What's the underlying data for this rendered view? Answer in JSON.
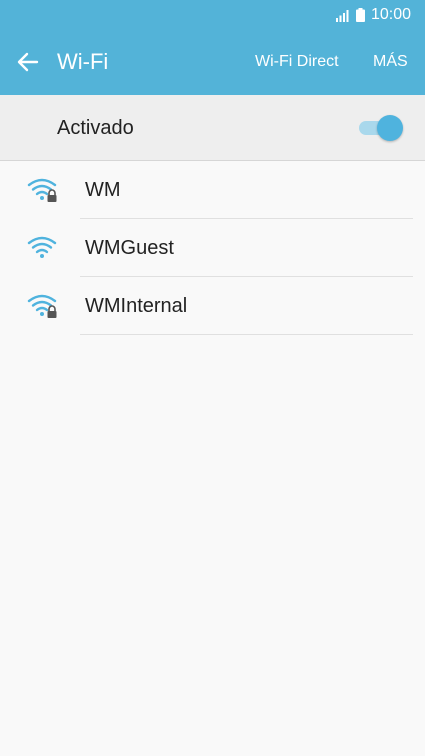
{
  "status_bar": {
    "time": "10:00",
    "icons": [
      "signal-icon",
      "battery-icon"
    ]
  },
  "app_bar": {
    "back_icon": "arrow-left-icon",
    "title": "Wi-Fi",
    "wifi_direct_label": "Wi-Fi Direct",
    "more_label": "MÁS"
  },
  "toggle": {
    "label": "Activado",
    "state": "on"
  },
  "networks": [
    {
      "name": "WM",
      "locked": true
    },
    {
      "name": "WMGuest",
      "locked": false
    },
    {
      "name": "WMInternal",
      "locked": true
    }
  ],
  "colors": {
    "header": "#53b3d8",
    "accent": "#4fb3de",
    "background": "#f9f9f9"
  }
}
